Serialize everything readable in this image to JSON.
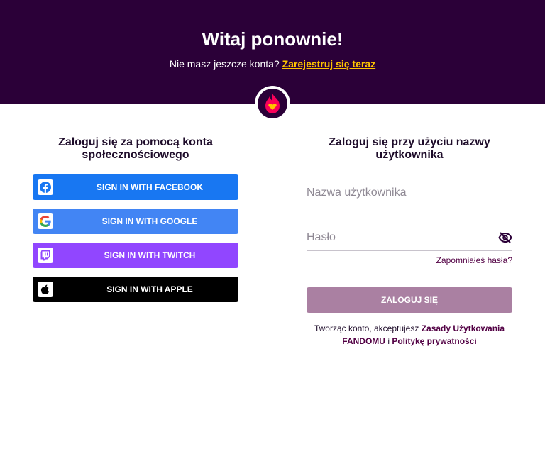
{
  "header": {
    "title": "Witaj ponownie!",
    "subtitle_text": "Nie masz jeszcze konta?",
    "register_link": "Zarejestruj się teraz",
    "background_color": "#2b0038",
    "link_color": "#ffc500"
  },
  "logo": {
    "icon": "fandom-heart-flame-icon"
  },
  "social_login": {
    "title": "Zaloguj się za pomocą konta społecznościowego",
    "buttons": [
      {
        "label": "SIGN IN WITH FACEBOOK",
        "icon": "facebook-icon",
        "color": "#1877f2"
      },
      {
        "label": "SIGN IN WITH GOOGLE",
        "icon": "google-icon",
        "color": "#4285f4"
      },
      {
        "label": "SIGN IN WITH TWITCH",
        "icon": "twitch-icon",
        "color": "#9146ff"
      },
      {
        "label": "SIGN IN WITH APPLE",
        "icon": "apple-icon",
        "color": "#000000"
      }
    ]
  },
  "username_login": {
    "title": "Zaloguj się przy użyciu nazwy użytkownika",
    "username_placeholder": "Nazwa użytkownika",
    "username_value": "",
    "password_placeholder": "Hasło",
    "password_value": "",
    "password_toggle_icon": "eye-slash-icon",
    "forgot_link": "Zapomniałeś hasła?",
    "submit_label": "ZALOGUJ SIĘ",
    "submit_color": "#aa80a2",
    "terms_prefix": "Tworząc konto, akceptujesz",
    "terms_link": "Zasady Użytkowania FANDOMU",
    "terms_and": "i",
    "privacy_link": "Politykę prywatności"
  }
}
